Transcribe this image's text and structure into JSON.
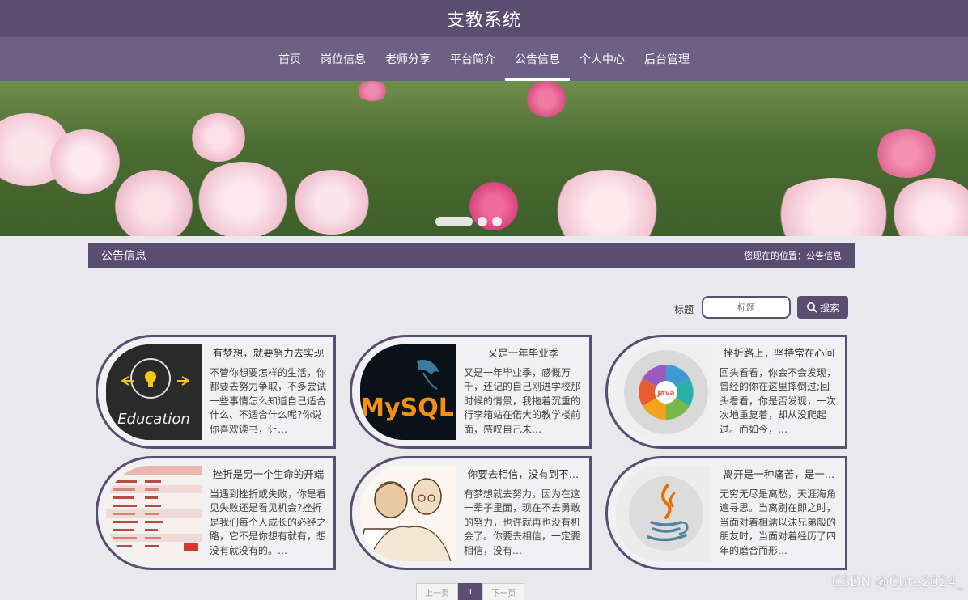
{
  "site": {
    "title": "支教系统"
  },
  "nav": {
    "items": [
      {
        "label": "首页",
        "active": false
      },
      {
        "label": "岗位信息",
        "active": false
      },
      {
        "label": "老师分享",
        "active": false
      },
      {
        "label": "平台简介",
        "active": false
      },
      {
        "label": "公告信息",
        "active": true
      },
      {
        "label": "个人中心",
        "active": false
      },
      {
        "label": "后台管理",
        "active": false
      }
    ]
  },
  "section": {
    "title": "公告信息",
    "breadcrumb": "您现在的位置：公告信息"
  },
  "search": {
    "label": "标题",
    "placeholder": "标题",
    "button_label": "搜索"
  },
  "cards": [
    {
      "title": "有梦想，就要努力去实现",
      "body": "不管你想要怎样的生活，你都要去努力争取，不多尝试一些事情怎么知道自己适合什么、不适合什么呢?你说你喜欢读书，让…",
      "thumb_text": "Education"
    },
    {
      "title": "又是一年毕业季",
      "body": "又是一年毕业季，感慨万千，还记的自己刚进学校那时候的情景，我拖着沉重的行李箱站在偌大的教学楼前面，感叹自己未…",
      "thumb_text": "MySQL"
    },
    {
      "title": "挫折路上，坚持常在心间",
      "body": "回头看看，你会不会发现，曾经的你在这里摔倒过;回头看看，你是否发现，一次次地重复着，却从没爬起过。而如今，…",
      "thumb_text": "Java"
    },
    {
      "title": "挫折是另一个生命的开端",
      "body": "当遇到挫折或失败，你是看见失败还是看见机会?挫折是我们每个人成长的必经之路，它不是你想有就有，想没有就没有的。…",
      "thumb_text": ""
    },
    {
      "title": "你要去相信，没有到不…",
      "body": "有梦想就去努力，因为在这一辈子里面，现在不去勇敢的努力，也许就再也没有机会了。你要去相信，一定要相信，没有…",
      "thumb_text": ""
    },
    {
      "title": "离开是一种痛苦，是一…",
      "body": "无穷无尽是离愁，天涯海角遍寻思。当离别在即之时，当面对着相濡以沫兄弟般的朋友时，当面对着经历了四年的磨合而形…",
      "thumb_text": ""
    }
  ],
  "pagination": {
    "prev_label": "上一页",
    "current": "1",
    "next_label": "下一页"
  },
  "watermark": "CSDN @Cute2024_",
  "colors": {
    "primary": "#5a4d72",
    "nav": "#6c6085",
    "background": "#e9e8ec"
  }
}
